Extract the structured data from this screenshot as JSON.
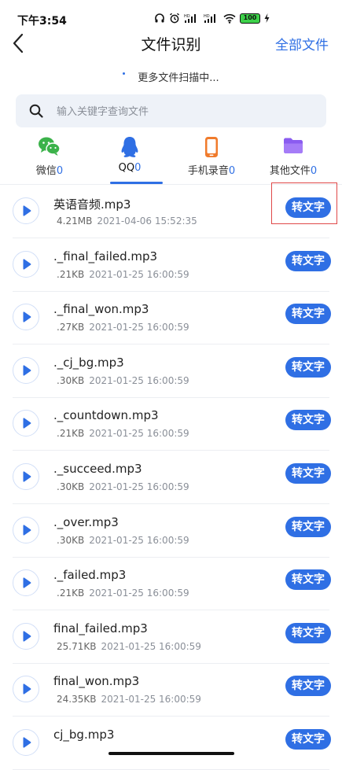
{
  "status_bar": {
    "time": "下午3:54",
    "battery": "100"
  },
  "header": {
    "title": "文件识别",
    "all_files_label": "全部文件"
  },
  "scan_status": "更多文件扫描中...",
  "search": {
    "placeholder": "输入关键字查询文件"
  },
  "tabs": [
    {
      "label": "微信",
      "count": "0",
      "icon": "wechat-icon",
      "color": "#3bb24a"
    },
    {
      "label": "QQ",
      "count": "0",
      "icon": "qq-icon",
      "color": "#2f6fe4"
    },
    {
      "label": "手机录音",
      "count": "0",
      "icon": "phone-icon",
      "color": "#f07b2c"
    },
    {
      "label": "其他文件",
      "count": "0",
      "icon": "folder-icon",
      "color": "#8a5cf0"
    }
  ],
  "convert_label": "转文字",
  "files": [
    {
      "name": "英语音频.mp3",
      "size": "4.21MB",
      "date": "2021-04-06 15:52:35"
    },
    {
      "name": "._final_failed.mp3",
      "size": ".21KB",
      "date": "2021-01-25 16:00:59"
    },
    {
      "name": "._final_won.mp3",
      "size": ".27KB",
      "date": "2021-01-25 16:00:59"
    },
    {
      "name": "._cj_bg.mp3",
      "size": ".30KB",
      "date": "2021-01-25 16:00:59"
    },
    {
      "name": "._countdown.mp3",
      "size": ".21KB",
      "date": "2021-01-25 16:00:59"
    },
    {
      "name": "._succeed.mp3",
      "size": ".30KB",
      "date": "2021-01-25 16:00:59"
    },
    {
      "name": "._over.mp3",
      "size": ".30KB",
      "date": "2021-01-25 16:00:59"
    },
    {
      "name": "._failed.mp3",
      "size": ".21KB",
      "date": "2021-01-25 16:00:59"
    },
    {
      "name": "final_failed.mp3",
      "size": "25.71KB",
      "date": "2021-01-25 16:00:59"
    },
    {
      "name": "final_won.mp3",
      "size": "24.35KB",
      "date": "2021-01-25 16:00:59"
    },
    {
      "name": "cj_bg.mp3",
      "size": "",
      "date": ""
    }
  ],
  "colors": {
    "accent": "#2f6fe4",
    "highlight": "#e04848"
  }
}
